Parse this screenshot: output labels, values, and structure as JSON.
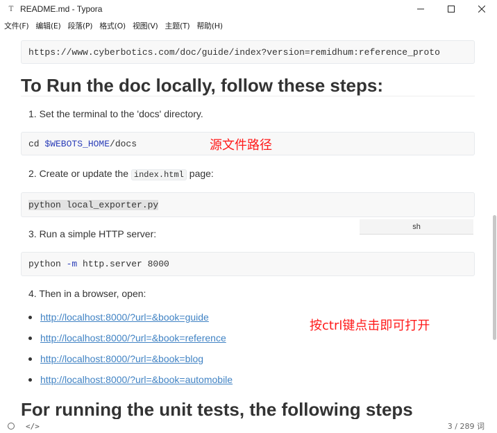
{
  "window": {
    "title": "README.md - Typora",
    "app_icon_glyph": "T",
    "minimize_glyph": "—",
    "maximize_glyph": "☐",
    "close_glyph": "✕"
  },
  "menu": [
    "文件(F)",
    "编辑(E)",
    "段落(P)",
    "格式(O)",
    "视图(V)",
    "主题(T)",
    "帮助(H)"
  ],
  "doc": {
    "top_code": "https://www.cyberbotics.com/doc/guide/index?version=remidhum:reference_proto",
    "heading_run": "To Run the doc locally, follow these steps:",
    "step1": "1. Set the terminal to the 'docs' directory.",
    "code1_prefix": "cd ",
    "code1_var": "$WEBOTS_HOME",
    "code1_suffix": "/docs",
    "annotation1": "源文件路径",
    "step2_prefix": "2. Create or update the ",
    "step2_code": "index.html",
    "step2_suffix": " page:",
    "code2": "python local_exporter.py",
    "lang_label": "sh",
    "step3": "3. Run a simple HTTP server:",
    "code3_prefix": "python ",
    "code3_opt": "-m",
    "code3_suffix": " http.server 8000",
    "step4": "4. Then in a browser, open:",
    "links": [
      "http://localhost:8000/?url=&book=guide",
      "http://localhost:8000/?url=&book=reference",
      "http://localhost:8000/?url=&book=blog",
      "http://localhost:8000/?url=&book=automobile"
    ],
    "annotation2": "按ctrl键点击即可打开",
    "heading_tests": "For running the unit tests, the following steps"
  },
  "status": {
    "source_mode_glyph": "</>",
    "word_count": "3 / 289 词"
  },
  "colors": {
    "link": "#4183c4",
    "annotation": "#ff1a1a",
    "code_background": "#f8f8f8"
  }
}
